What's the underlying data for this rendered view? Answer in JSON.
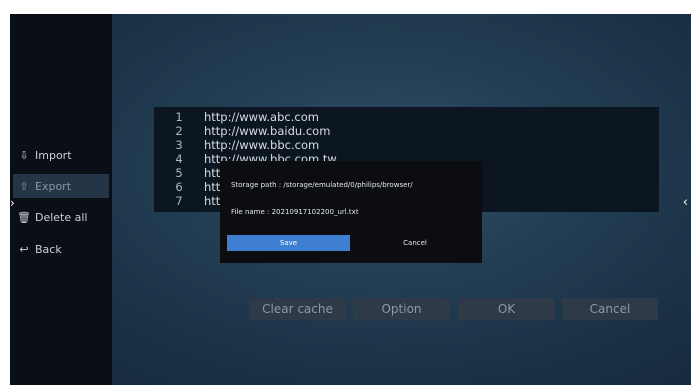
{
  "sidebar": {
    "items": [
      {
        "label": "Import",
        "icon": "import-icon",
        "glyph": "⇩"
      },
      {
        "label": "Export",
        "icon": "export-icon",
        "glyph": "⇧",
        "selected": true
      },
      {
        "label": "Delete all",
        "icon": "trash-icon",
        "glyph": "🗑"
      },
      {
        "label": "Back",
        "icon": "back-icon",
        "glyph": "↩"
      }
    ]
  },
  "urls": [
    {
      "num": "1",
      "url": "http://www.abc.com"
    },
    {
      "num": "2",
      "url": "http://www.baidu.com"
    },
    {
      "num": "3",
      "url": "http://www.bbc.com"
    },
    {
      "num": "4",
      "url": "http://www.bbc.com.tw"
    },
    {
      "num": "5",
      "url": "htt"
    },
    {
      "num": "6",
      "url": "htt"
    },
    {
      "num": "7",
      "url": "htt"
    }
  ],
  "buttons": {
    "clear_cache": "Clear cache",
    "option": "Option",
    "ok": "OK",
    "cancel": "Cancel"
  },
  "dialog": {
    "storage_path": "Storage path : /storage/emulated/0/philips/browser/",
    "file_name": "File name : 20210917102200_url.txt",
    "save": "Save",
    "cancel": "Cancel"
  },
  "arrows": {
    "left": "›",
    "right": "‹"
  },
  "colors": {
    "accent": "#3f7fd1",
    "sidebar_bg": "#0a0f15",
    "selected_bg": "#233546"
  }
}
